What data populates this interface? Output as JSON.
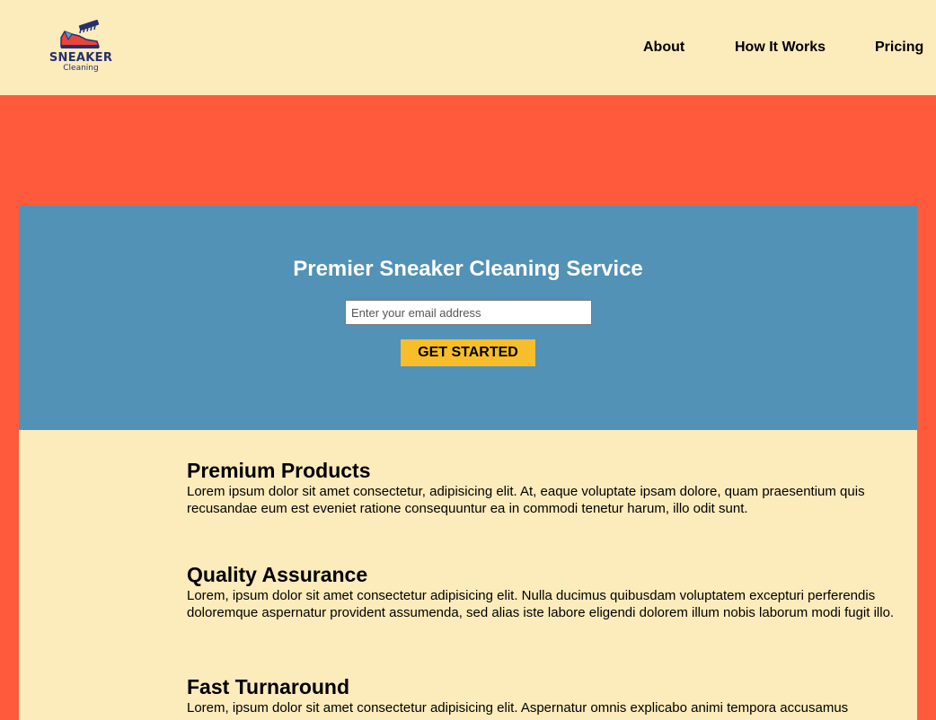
{
  "header": {
    "logo": {
      "title": "SNEAKER",
      "subtitle": "Cleaning",
      "icon": "sneaker-brush-icon"
    },
    "nav": [
      {
        "label": "About"
      },
      {
        "label": "How It Works"
      },
      {
        "label": "Pricing"
      }
    ]
  },
  "hero": {
    "title": "Premier Sneaker Cleaning Service",
    "email_placeholder": "Enter your email address",
    "email_value": "",
    "cta_label": "GET STARTED"
  },
  "features": [
    {
      "title": "Premium Products",
      "text": "Lorem ipsum dolor sit amet consectetur, adipisicing elit. At, eaque voluptate ipsam dolore, quam praesentium quis recusandae eum est eveniet ratione consequuntur ea in commodi tenetur harum, illo odit sunt."
    },
    {
      "title": "Quality Assurance",
      "text": "Lorem, ipsum dolor sit amet consectetur adipisicing elit. Nulla ducimus quibusdam voluptatem excepturi perferendis doloremque aspernatur provident assumenda, sed alias iste labore eligendi dolorem illum nobis laborum modi fugit illo."
    },
    {
      "title": "Fast Turnaround",
      "text": "Lorem, ipsum dolor sit amet consectetur adipisicing elit. Aspernatur omnis explicabo animi tempora accusamus"
    }
  ],
  "colors": {
    "page_background": "#ff5a3c",
    "header_background": "#fcebbb",
    "hero_background": "#5192b6",
    "cta_background": "#f8bd2a",
    "logo_text": "#26306e"
  }
}
